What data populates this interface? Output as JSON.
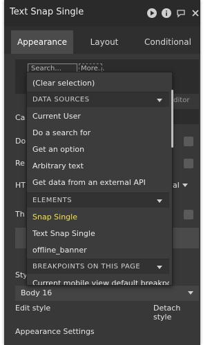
{
  "window": {
    "title": "Text Snap Single"
  },
  "tabs": [
    {
      "label": "Appearance"
    },
    {
      "label": "Layout"
    },
    {
      "label": "Conditional"
    }
  ],
  "search": {
    "placeholder": "Search...",
    "more": "More..."
  },
  "partial_labels": {
    "row1": "Ca",
    "row2": "Do",
    "row3": "Re",
    "row4": "HT",
    "row5": "Th",
    "row6": "Sty",
    "right_hint": "xt editor",
    "right_hint2": "al"
  },
  "dropdown": {
    "clear": "(Clear selection)",
    "sections": [
      {
        "header": "DATA SOURCES",
        "items": [
          "Current User",
          "Do a search for",
          "Get an option",
          "Arbitrary text",
          "Get data from an external API"
        ]
      },
      {
        "header": "ELEMENTS",
        "items": [
          "Snap Single",
          "Text Snap Single",
          "offline_banner"
        ]
      },
      {
        "header": "BREAKPOINTS ON THIS PAGE",
        "items": [
          "Current mobile view default breakpoint"
        ]
      }
    ]
  },
  "style_select": {
    "value": "Body 16",
    "edit_label": "Edit style",
    "detach_label": "Detach style"
  },
  "footer": {
    "appearance_settings": "Appearance Settings"
  },
  "colors": {
    "panel_bg": "#383838",
    "highlight_item": "#f2e24a"
  }
}
